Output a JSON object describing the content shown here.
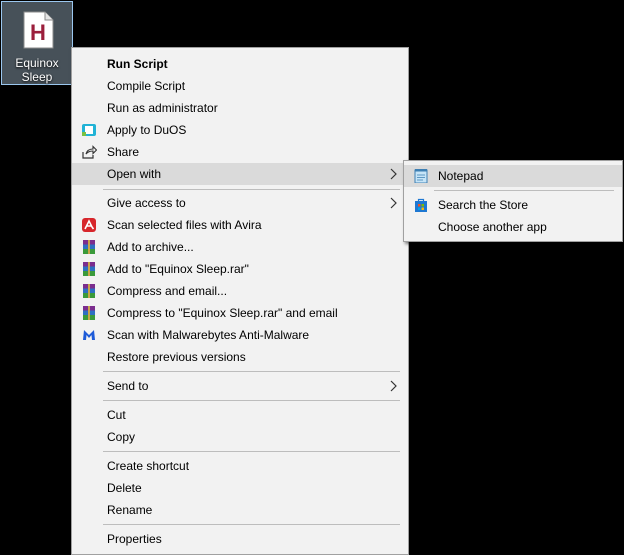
{
  "desktop": {
    "file_label": "Equinox Sleep",
    "file_icon": "autohotkey-script-file-icon",
    "file_icon_letter": "H"
  },
  "context_menu": {
    "items": [
      {
        "label": "Run Script"
      },
      {
        "label": "Compile Script"
      },
      {
        "label": "Run as administrator"
      },
      {
        "label": "Apply to DuOS",
        "icon": "duos-icon"
      },
      {
        "label": "Share",
        "icon": "share-icon"
      },
      {
        "label": "Open with",
        "has_submenu": true,
        "highlighted": true
      },
      {
        "label": "Give access to",
        "has_submenu": true
      },
      {
        "label": "Scan selected files with Avira",
        "icon": "avira-icon"
      },
      {
        "label": "Add to archive...",
        "icon": "winrar-icon"
      },
      {
        "label": "Add to \"Equinox Sleep.rar\"",
        "icon": "winrar-icon"
      },
      {
        "label": "Compress and email...",
        "icon": "winrar-icon"
      },
      {
        "label": "Compress to \"Equinox Sleep.rar\" and email",
        "icon": "winrar-icon"
      },
      {
        "label": "Scan with Malwarebytes Anti-Malware",
        "icon": "malwarebytes-icon"
      },
      {
        "label": "Restore previous versions"
      },
      {
        "label": "Send to",
        "has_submenu": true
      },
      {
        "label": "Cut"
      },
      {
        "label": "Copy"
      },
      {
        "label": "Create shortcut"
      },
      {
        "label": "Delete"
      },
      {
        "label": "Rename"
      },
      {
        "label": "Properties"
      }
    ]
  },
  "open_with_submenu": {
    "items": [
      {
        "label": "Notepad",
        "icon": "notepad-icon",
        "highlighted": true
      },
      {
        "label": "Search the Store",
        "icon": "store-icon"
      },
      {
        "label": "Choose another app"
      }
    ]
  },
  "colors": {
    "menu_bg": "#f2f2f2",
    "highlight": "#dadada",
    "desktop_bg": "#000000"
  }
}
